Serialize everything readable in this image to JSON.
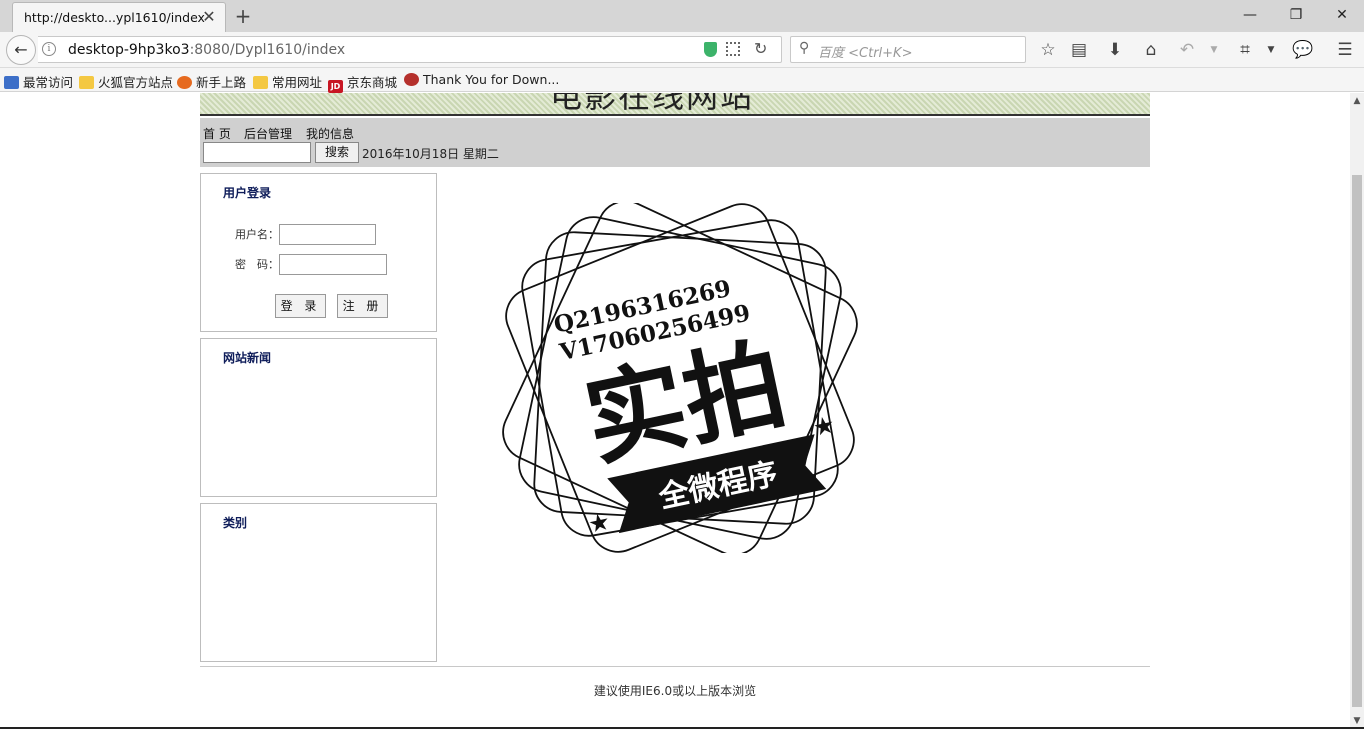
{
  "browser": {
    "tab_title": "http://deskto...ypl1610/index",
    "url_host": "desktop-9hp3ko3",
    "url_rest": ":8080/Dypl1610/index",
    "search_placeholder": "百度 <Ctrl+K>",
    "bookmarks": [
      "最常访问",
      "火狐官方站点",
      "新手上路",
      "常用网址",
      "京东商城",
      "Thank You for Down..."
    ]
  },
  "page": {
    "banner_title": "电影在线网站",
    "menu": [
      "首 页",
      "后台管理",
      "我的信息"
    ],
    "search_button": "搜索",
    "date": "2016年10月18日 星期二",
    "login": {
      "title": "用户登录",
      "username_label": "用户名：",
      "password_label": "密　码：",
      "login_button": "登 录",
      "register_button": "注 册"
    },
    "news_title": "网站新闻",
    "category_title": "类别",
    "footer": "建议使用IE6.0或以上版本浏览"
  },
  "stamp": {
    "line1": "Q2196316269",
    "line2": "V17060256499",
    "big": "实拍",
    "ribbon": "全微程序"
  }
}
